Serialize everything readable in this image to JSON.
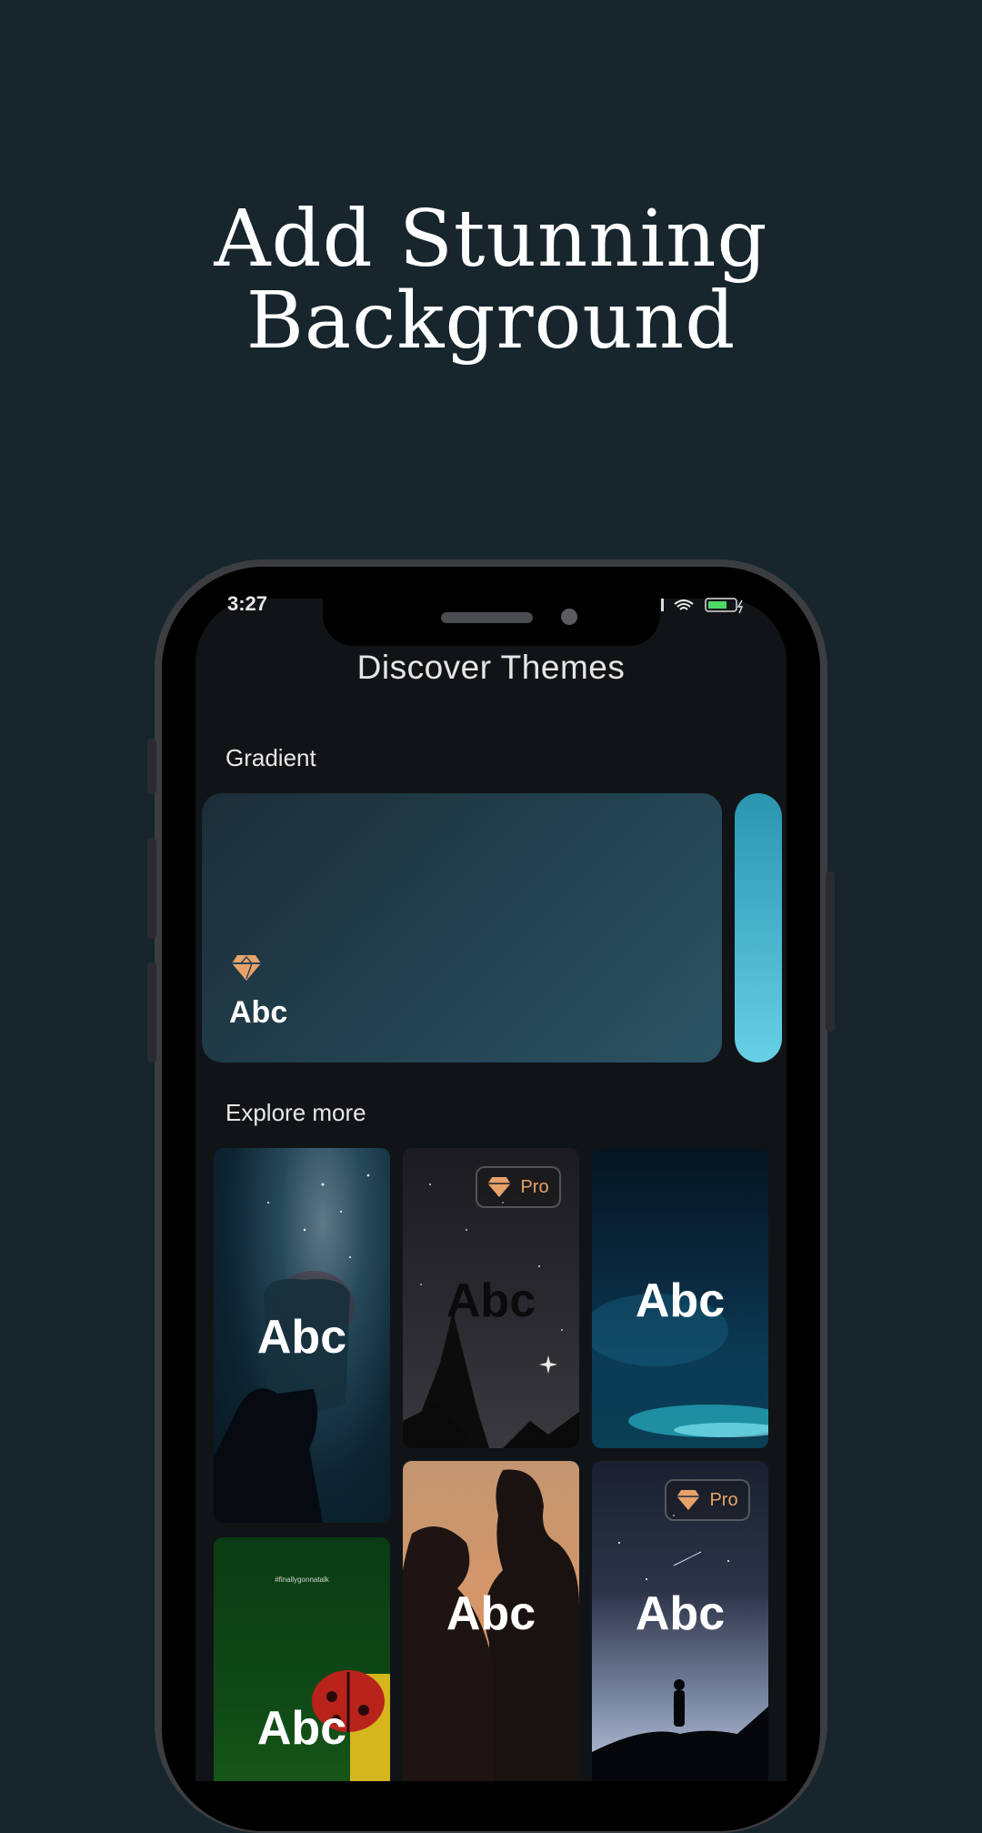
{
  "headline": {
    "line1": "Add Stunning",
    "line2": "Background"
  },
  "status_bar": {
    "time": "3:27"
  },
  "screen": {
    "title": "Discover Themes",
    "gradient_section": {
      "label": "Gradient",
      "card_text": "Abc"
    },
    "explore_section": {
      "label": "Explore more",
      "tiles": [
        {
          "text": "Abc",
          "pro": false,
          "theme": "galaxy-jar"
        },
        {
          "text": "Abc",
          "pro": true,
          "pro_label": "Pro",
          "theme": "starry-forest"
        },
        {
          "text": "Abc",
          "pro": false,
          "theme": "aurora"
        },
        {
          "text": "Abc",
          "pro": false,
          "theme": "ladybug-green",
          "caption": "#finallygonnatalk"
        },
        {
          "text": "Abc",
          "pro": false,
          "theme": "couple-sunset"
        },
        {
          "text": "Abc",
          "pro": true,
          "pro_label": "Pro",
          "theme": "night-hiker"
        }
      ]
    }
  },
  "colors": {
    "background": "#17252d",
    "screen": "#111417",
    "accent_pro": "#e7a269",
    "gradient_peek": "#4fb8d3"
  }
}
